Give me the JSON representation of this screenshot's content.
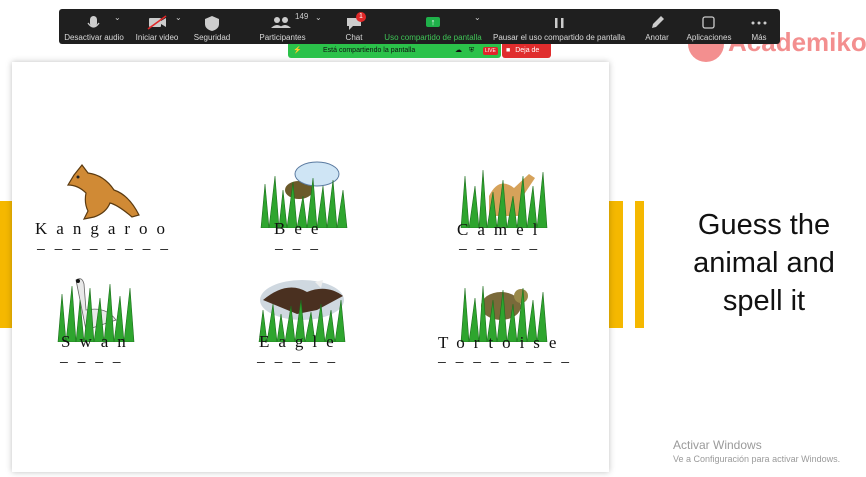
{
  "toolbar": {
    "mute": "Desactivar audio",
    "video": "Iniciar video",
    "security": "Seguridad",
    "participants": "Participantes",
    "participants_count": "149",
    "chat": "Chat",
    "chat_badge": "1",
    "share": "Uso compartido de pantalla",
    "pause": "Pausar el uso compartido de pantalla",
    "annotate": "Anotar",
    "apps": "Aplicaciones",
    "more": "Más"
  },
  "banner": {
    "text": "Está compartiendo la pantalla",
    "live": "LIVE",
    "stop": "Deja de"
  },
  "logo": {
    "text": "Academiko"
  },
  "slide": {
    "animals": [
      {
        "word": "Kangaroo",
        "blanks": "— — — — — — — —"
      },
      {
        "word": "Bee",
        "blanks": "— — —"
      },
      {
        "word": "Camel",
        "blanks": "— — — — —"
      },
      {
        "word": "Swan",
        "blanks": "— — — —"
      },
      {
        "word": "Eagle",
        "blanks": "— — — — —"
      },
      {
        "word": "Tortoise",
        "blanks": "— — — — — — — —"
      }
    ],
    "guess_line1": "Guess the",
    "guess_line2": "animal and",
    "guess_line3": "spell it"
  },
  "activation": {
    "title": "Activar Windows",
    "subtitle": "Ve a Configuración para activar Windows."
  },
  "colors": {
    "stripe": "#f5b800",
    "toolbar": "#1f1f1f",
    "share_green": "#2bc24a",
    "stop_red": "#e02d2d"
  }
}
